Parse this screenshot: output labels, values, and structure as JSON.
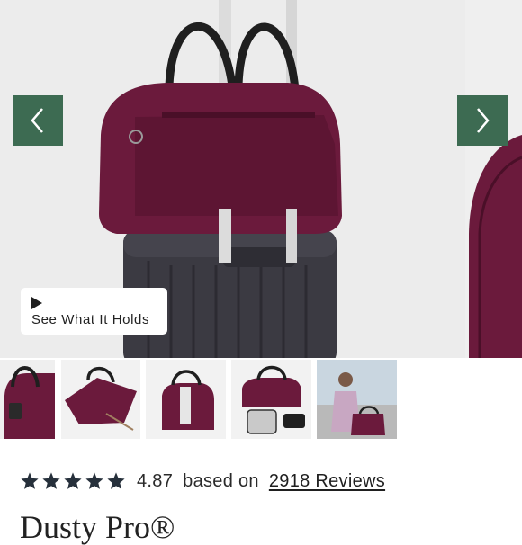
{
  "colors": {
    "nav_button_bg": "#3d6b52",
    "bag_purple": "#6b1a3c",
    "suitcase": "#3b3a42",
    "star": "#26303b"
  },
  "gallery": {
    "prev_icon": "chevron-left-icon",
    "next_icon": "chevron-right-icon",
    "video_button": {
      "icon": "play-icon",
      "label": "See What It Holds"
    }
  },
  "thumbnails": [
    "bag-with-luggage-tag",
    "bag-open-pocket",
    "bag-side-view",
    "bag-with-accessories",
    "man-with-bag-lifestyle"
  ],
  "rating": {
    "stars": 5,
    "value": "4.87",
    "based_on": "based on",
    "reviews_link": "2918 Reviews"
  },
  "product": {
    "title_partial": "Dusty Pro®"
  }
}
